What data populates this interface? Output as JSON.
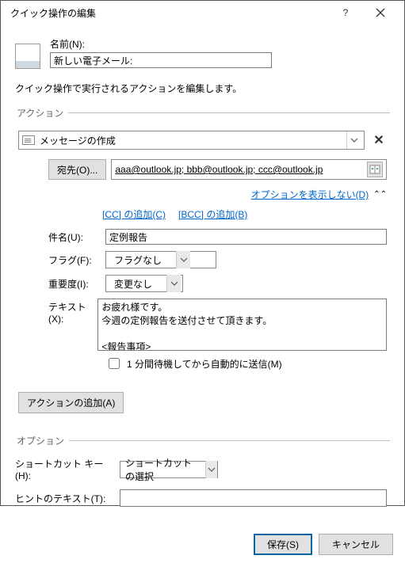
{
  "titlebar": {
    "title": "クイック操作の編集"
  },
  "name": {
    "label": "名前(N):",
    "value": "新しい電子メール:"
  },
  "description": "クイック操作で実行されるアクションを編集します。",
  "actionsGroup": {
    "legend": "アクション"
  },
  "action": {
    "selected": "メッセージの作成",
    "to_button": "宛先(O)...",
    "to_value": "aaa@outlook.jp; bbb@outlook.jp; ccc@outlook.jp",
    "options_link": "オプションを表示しない(D)",
    "cc_link": "[CC] の追加(C)",
    "bcc_link": "[BCC] の追加(B)",
    "subject_label": "件名(U):",
    "subject_value": "定例報告",
    "flag_label": "フラグ(F):",
    "flag_value": "フラグなし",
    "importance_label": "重要度(I):",
    "importance_value": "変更なし",
    "text_label": "テキスト(X):",
    "text_value": "お疲れ様です。\n今週の定例報告を送付させて頂きます。\n\n<報告事項>",
    "autosend_label": "1 分間待機してから自動的に送信(M)"
  },
  "addAction": "アクションの追加(A)",
  "optionsGroup": {
    "legend": "オプション"
  },
  "options": {
    "shortcut_label": "ショートカット キー(H):",
    "shortcut_value": "ショートカットの選択",
    "tooltip_label": "ヒントのテキスト(T):",
    "tooltip_value": ""
  },
  "footer": {
    "save": "保存(S)",
    "cancel": "キャンセル"
  }
}
